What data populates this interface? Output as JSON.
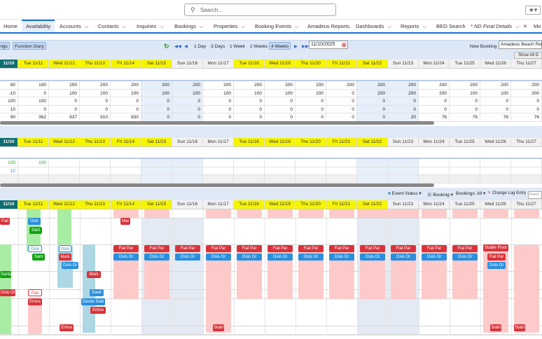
{
  "search": {
    "placeholder": "Search..."
  },
  "nav": [
    {
      "label": "Home"
    },
    {
      "label": "Availability",
      "active": true
    },
    {
      "label": "Accounts",
      "chev": true
    },
    {
      "label": "Contacts",
      "chev": true
    },
    {
      "label": "Inquiries",
      "chev": true
    },
    {
      "label": "Bookings",
      "chev": true
    },
    {
      "label": "Properties",
      "chev": true
    },
    {
      "label": "Booking Events",
      "chev": true
    },
    {
      "label": "Amadeus Reports"
    },
    {
      "label": "Dashboards",
      "chev": true
    },
    {
      "label": "Reports",
      "chev": true
    },
    {
      "label": "BEO Search"
    },
    {
      "label": "* ND Final Details",
      "chev": true,
      "close": true
    },
    {
      "label": "Mo"
    }
  ],
  "toolbar": {
    "bookings": "ings",
    "function_diary": "Function Diary",
    "ranges": [
      "1 Day",
      "3 Days",
      "1 Week",
      "2 Weeks",
      "4 Weeks"
    ],
    "selected_range": "4 Weeks",
    "date": "11/10/2025",
    "new_booking": "New Booking",
    "property": "Amadeus Beach Resort",
    "show_all": "Show All G"
  },
  "days": [
    {
      "l": "11/10",
      "t": "today"
    },
    {
      "l": "Tue 11/11",
      "y": 1
    },
    {
      "l": "Wed 11/12",
      "y": 1
    },
    {
      "l": "Thu 11/13",
      "y": 1
    },
    {
      "l": "Fri 11/14",
      "y": 1
    },
    {
      "l": "Sat 11/15",
      "y": 1
    },
    {
      "l": "Sun 11/16"
    },
    {
      "l": "Mon 11/17"
    },
    {
      "l": "Tue 11/18",
      "y": 1
    },
    {
      "l": "Wed 11/19",
      "y": 1
    },
    {
      "l": "Thu 11/20",
      "y": 1
    },
    {
      "l": "Fri 11/21",
      "y": 1
    },
    {
      "l": "Sat 11/22",
      "y": 1
    },
    {
      "l": "Sun 11/23"
    },
    {
      "l": "Mon 11/24"
    },
    {
      "l": "Tue 11/25"
    },
    {
      "l": "Wed 11/26"
    },
    {
      "l": "Thu 11/27"
    }
  ],
  "availability": [
    [
      "90",
      "100",
      "200",
      "200",
      "200",
      "200",
      "200",
      "200",
      "200",
      "200",
      "200",
      "200",
      "200",
      "200",
      "200",
      "200",
      "200",
      "200"
    ],
    [
      "-10",
      "0",
      "100",
      "100",
      "100",
      "100",
      "100",
      "100",
      "100",
      "100",
      "200",
      "0",
      "200",
      "200",
      "200",
      "100",
      "100",
      "200"
    ],
    [
      "100",
      "100",
      "0",
      "0",
      "0",
      "0",
      "0",
      "0",
      "0",
      "0",
      "0",
      "0",
      "0",
      "0",
      "0",
      "0",
      "0",
      "0"
    ],
    [
      "10",
      "0",
      "0",
      "0",
      "0",
      "0",
      "0",
      "0",
      "0",
      "0",
      "0",
      "0",
      "0",
      "0",
      "0",
      "0",
      "0",
      "0"
    ],
    [
      "90",
      "362",
      "937",
      "910",
      "830",
      "0",
      "0",
      "0",
      "0",
      "0",
      "0",
      "0",
      "0",
      "20",
      "76",
      "76",
      "76",
      "76"
    ]
  ],
  "function_rows": [
    [
      "100",
      "100"
    ],
    [
      "10",
      ""
    ],
    [
      "",
      ""
    ]
  ],
  "gantt_toolbar": {
    "event_status": "Event Status",
    "booking": "Booking",
    "bookings_all": "Bookings: All",
    "change_log": "Change Log Entry",
    "function_placeholder": "Funct"
  },
  "events": [
    "Fiat",
    "Oslo",
    "Sant",
    "Mai",
    "Oslo",
    "Oslo",
    "Sant",
    "Mark",
    "Oslo Or",
    "Santa",
    "Mark",
    "Oslo Ora",
    "Fiat",
    "Davit",
    "Emira",
    "Davita Sale",
    "Emira",
    "Emira",
    "Stabl",
    "Stable Floor",
    "Fiat Par",
    "Oslo Or",
    "Stabl",
    "Stabl"
  ],
  "repeat_events": {
    "top": "Fiat Par",
    "bottom": "Oslo Or"
  }
}
